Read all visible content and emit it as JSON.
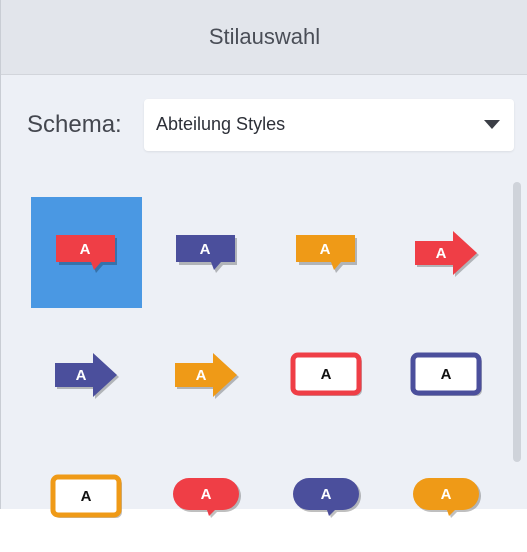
{
  "header": {
    "title": "Stilauswahl"
  },
  "schema": {
    "label": "Schema:",
    "value": "Abteilung Styles"
  },
  "colors": {
    "selection": "#4a98e3",
    "red": "#ef3e46",
    "blue": "#4b4f9c",
    "orange": "#ef9a17"
  },
  "styles": [
    {
      "name": "callout-red",
      "icon": "speech-bubble-rect",
      "color": "red",
      "letter": "A",
      "selected": true
    },
    {
      "name": "callout-blue",
      "icon": "speech-bubble-rect",
      "color": "blue",
      "letter": "A",
      "selected": false
    },
    {
      "name": "callout-orange",
      "icon": "speech-bubble-rect",
      "color": "orange",
      "letter": "A",
      "selected": false
    },
    {
      "name": "arrow-red",
      "icon": "arrow",
      "color": "red",
      "letter": "A",
      "selected": false
    },
    {
      "name": "arrow-blue",
      "icon": "arrow",
      "color": "blue",
      "letter": "A",
      "selected": false
    },
    {
      "name": "arrow-orange",
      "icon": "arrow",
      "color": "orange",
      "letter": "A",
      "selected": false
    },
    {
      "name": "box-red",
      "icon": "outlined-box",
      "color": "red",
      "letter": "A",
      "selected": false
    },
    {
      "name": "box-blue",
      "icon": "outlined-box",
      "color": "blue",
      "letter": "A",
      "selected": false
    },
    {
      "name": "box-orange",
      "icon": "outlined-box",
      "color": "orange",
      "letter": "A",
      "selected": false
    },
    {
      "name": "pill-red",
      "icon": "speech-pill",
      "color": "red",
      "letter": "A",
      "selected": false
    },
    {
      "name": "pill-blue",
      "icon": "speech-pill",
      "color": "blue",
      "letter": "A",
      "selected": false
    },
    {
      "name": "pill-orange",
      "icon": "speech-pill",
      "color": "orange",
      "letter": "A",
      "selected": false
    }
  ]
}
